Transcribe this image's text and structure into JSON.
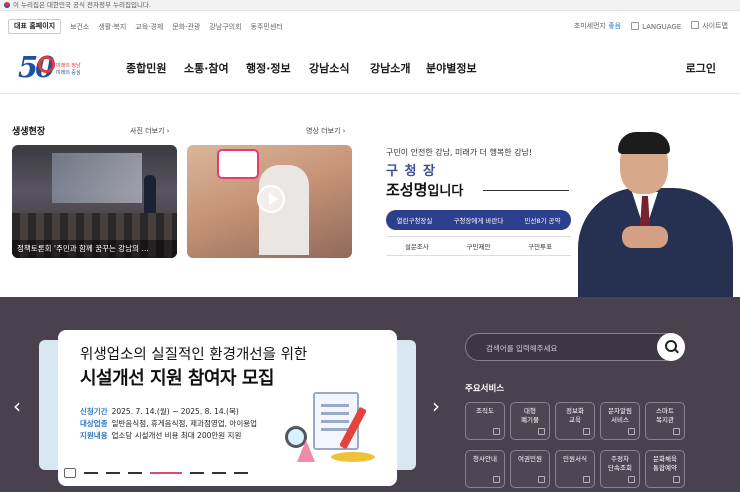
{
  "gov_notice": "이 누리집은 대한민국 공식 전자정부 누리집입니다.",
  "util": {
    "rep_page": "대표 홈페이지",
    "links": [
      "보건소",
      "생활·복지",
      "교육·경제",
      "문화·관광",
      "강남구의회",
      "동주민센터"
    ],
    "dust_label": "초미세먼지",
    "dust_value": "좋음",
    "language": "LANGUAGE",
    "sitemap": "사이트맵"
  },
  "logo": {
    "number": "50",
    "tag1": "미래의 정남",
    "tag2": "미래의 중심"
  },
  "menu": [
    "종합민원",
    "소통·참여",
    "행정·정보",
    "강남소식",
    "강남소개",
    "분야별정보"
  ],
  "login": "로그인",
  "news": {
    "title": "생생현장",
    "more_photo": "사진 더보기",
    "more_video": "영상 더보기",
    "card1_caption": "정책토론회 '주민과 함께 꿈꾸는 강남의 …"
  },
  "mayor": {
    "slogan": "구민이 안전한 강남, 미래가 더 행복한 강남!",
    "role": "구 청 장",
    "name": "조성명",
    "name_suffix": "입니다",
    "buttons": [
      "열린구청장실",
      "구청장에게 바란다",
      "민선8기 공약"
    ],
    "sub_links": [
      "설문조사",
      "구민제안",
      "구민투표"
    ]
  },
  "banner": {
    "title1": "위생업소의 실질적인 환경개선을 위한",
    "title2": "시설개선 지원 참여자 모집",
    "rows": [
      {
        "k": "신청기간",
        "v": "2025. 7. 14.(월) ~ 2025. 8. 14.(목)"
      },
      {
        "k": "대상업종",
        "v": "일반음식점, 휴게음식점, 제과점영업, 아이용업"
      },
      {
        "k": "지원내용",
        "v": "업소당 시설개선 비용 최대 200만원 지원"
      }
    ]
  },
  "search": {
    "placeholder": "검색어를 입력해주세요"
  },
  "services": {
    "title": "주요서비스",
    "items": [
      "조직도",
      "대형\n폐기물",
      "정보화\n교육",
      "문자알림\n서비스",
      "스마트\n복지관",
      "청사안내",
      "여권민원",
      "민원서식",
      "주정차\n단속조회",
      "문화체육\n통합예약"
    ]
  },
  "colors": {
    "brand_blue": "#2c3f8f",
    "dark_bg": "#4a414e",
    "accent_pink": "#e0486c",
    "logo_blue": "#1e4fa0"
  }
}
